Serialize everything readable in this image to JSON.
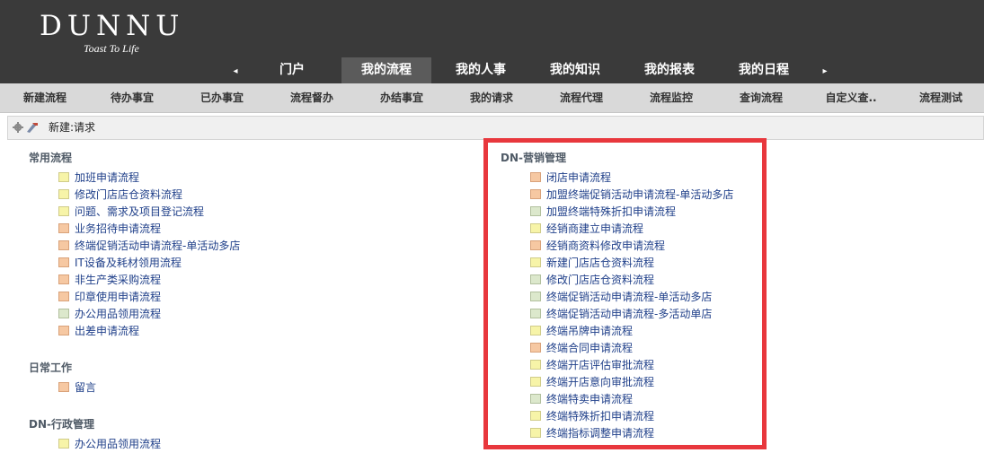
{
  "logo": {
    "name": "DUNNU",
    "tagline": "Toast To Life"
  },
  "main_tabs": [
    "门户",
    "我的流程",
    "我的人事",
    "我的知识",
    "我的报表",
    "我的日程"
  ],
  "active_main_tab": "我的流程",
  "nav": {
    "left_arrow": "◂",
    "right_arrow": "▸"
  },
  "sub_tabs": [
    "新建流程",
    "待办事宜",
    "已办事宜",
    "流程督办",
    "办结事宜",
    "我的请求",
    "流程代理",
    "流程监控",
    "查询流程",
    "自定义查..",
    "流程测试"
  ],
  "breadcrumb": "新建:请求",
  "groups": {
    "changyong": {
      "title": "常用流程",
      "items": [
        {
          "label": "加班申请流程",
          "color": "y"
        },
        {
          "label": "修改门店店仓资料流程",
          "color": "y"
        },
        {
          "label": "问题、需求及项目登记流程",
          "color": "y"
        },
        {
          "label": "业务招待申请流程",
          "color": "o"
        },
        {
          "label": "终端促销活动申请流程-单活动多店",
          "color": "o"
        },
        {
          "label": "IT设备及耗材领用流程",
          "color": "o"
        },
        {
          "label": "非生产类采购流程",
          "color": "o"
        },
        {
          "label": "印章使用申请流程",
          "color": "o"
        },
        {
          "label": "办公用品领用流程",
          "color": "g"
        },
        {
          "label": "出差申请流程",
          "color": "o"
        }
      ]
    },
    "richang": {
      "title": "日常工作",
      "items": [
        {
          "label": "留言",
          "color": "o"
        }
      ]
    },
    "xingzheng": {
      "title": "DN-行政管理",
      "items": [
        {
          "label": "办公用品领用流程",
          "color": "y"
        }
      ]
    },
    "yingxiao": {
      "title": "DN-营销管理",
      "items": [
        {
          "label": "闭店申请流程",
          "color": "o"
        },
        {
          "label": "加盟终端促销活动申请流程-单活动多店",
          "color": "o"
        },
        {
          "label": "加盟终端特殊折扣申请流程",
          "color": "g"
        },
        {
          "label": "经销商建立申请流程",
          "color": "y"
        },
        {
          "label": "经销商资料修改申请流程",
          "color": "o"
        },
        {
          "label": "新建门店店仓资料流程",
          "color": "y"
        },
        {
          "label": "修改门店店仓资料流程",
          "color": "g"
        },
        {
          "label": "终端促销活动申请流程-单活动多店",
          "color": "g"
        },
        {
          "label": "终端促销活动申请流程-多活动单店",
          "color": "g"
        },
        {
          "label": "终端吊牌申请流程",
          "color": "y"
        },
        {
          "label": "终端合同申请流程",
          "color": "o"
        },
        {
          "label": "终端开店评估审批流程",
          "color": "y"
        },
        {
          "label": "终端开店意向审批流程",
          "color": "y"
        },
        {
          "label": "终端特卖申请流程",
          "color": "g"
        },
        {
          "label": "终端特殊折扣申请流程",
          "color": "y"
        },
        {
          "label": "终端指标调整申请流程",
          "color": "y"
        }
      ]
    }
  },
  "colors": {
    "header_bg": "#3a3a3a",
    "highlight": "#e8373d",
    "link": "#20408a"
  }
}
